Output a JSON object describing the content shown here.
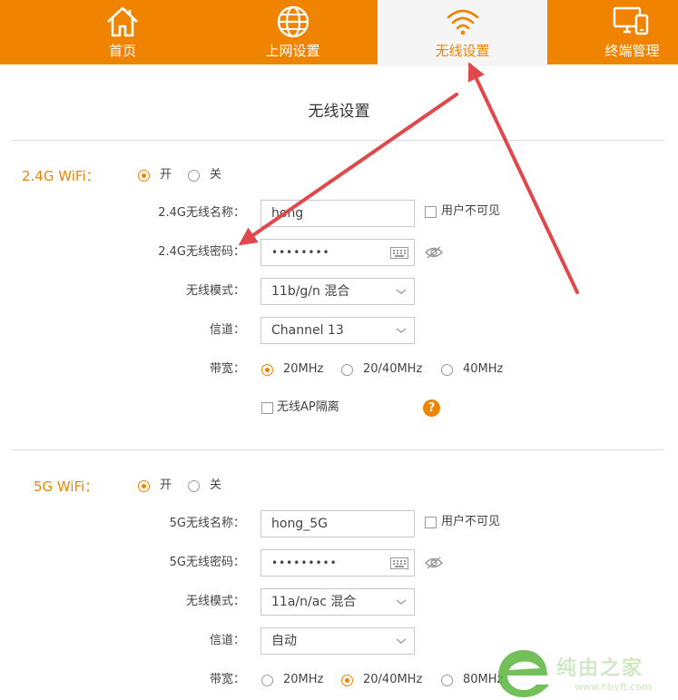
{
  "nav": {
    "items": [
      {
        "label": "首页",
        "icon": "home-icon"
      },
      {
        "label": "上网设置",
        "icon": "globe-icon"
      },
      {
        "label": "无线设置",
        "icon": "wifi-icon",
        "active": true
      },
      {
        "label": "终端管理",
        "icon": "devices-icon"
      }
    ]
  },
  "page": {
    "title": "无线设置"
  },
  "wifi24": {
    "section_label": "2.4G WiFi：",
    "on_label": "开",
    "off_label": "关",
    "state": "on",
    "name_label": "2.4G无线名称：",
    "name_value": "hong",
    "hidden_label": "用户不可见",
    "password_label": "2.4G无线密码：",
    "password_value": "••••••••",
    "mode_label": "无线模式：",
    "mode_value": "11b/g/n 混合",
    "channel_label": "信道：",
    "channel_value": "Channel 13",
    "bandwidth_label": "带宽：",
    "bandwidth_options": [
      "20MHz",
      "20/40MHz",
      "40MHz"
    ],
    "bandwidth_selected": "20MHz",
    "ap_isolation_label": "无线AP隔离",
    "help_glyph": "?"
  },
  "wifi5": {
    "section_label": "5G WiFi：",
    "on_label": "开",
    "off_label": "关",
    "state": "on",
    "name_label": "5G无线名称：",
    "name_value": "hong_5G",
    "hidden_label": "用户不可见",
    "password_label": "5G无线密码：",
    "password_value": "•••••••••",
    "mode_label": "无线模式：",
    "mode_value": "11a/n/ac 混合",
    "channel_label": "信道：",
    "channel_value": "自动",
    "bandwidth_label": "带宽：",
    "bandwidth_options": [
      "20MHz",
      "20/40MHz",
      "80MHz"
    ],
    "bandwidth_selected": "20/40MHz"
  },
  "watermark": {
    "text": "纯由之家",
    "url": "www.hbyft.com"
  },
  "colors": {
    "accent": "#f08300",
    "annotation_arrow": "#e0484b"
  }
}
